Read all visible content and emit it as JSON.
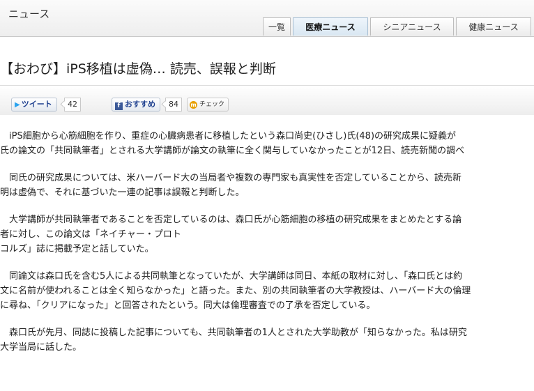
{
  "header": {
    "section_title": "ニュース",
    "tabs": [
      {
        "label": "一覧",
        "active": false
      },
      {
        "label": "医療ニュース",
        "active": true
      },
      {
        "label": "シニアニュース",
        "active": false
      },
      {
        "label": "健康ニュース",
        "active": false
      }
    ]
  },
  "article": {
    "headline": "【おわび】iPS移植は虚偽… 読売、誤報と判断",
    "paragraphs": [
      [
        "　iPS細胞から心筋細胞を作り、重症の心臓病患者に移植したという森口尚史(ひさし)氏(48)の研究成果に疑義が",
        "氏の論文の「共同執筆者」とされる大学講師が論文の執筆に全く関与していなかったことが12日、読売新聞の調べ"
      ],
      [
        "　同氏の研究成果については、米ハーバード大の当局者や複数の専門家も真実性を否定していることから、読売新",
        "明は虚偽で、それに基づいた一連の記事は誤報と判断した。"
      ],
      [
        "　大学講師が共同執筆者であることを否定しているのは、森口氏が心筋細胞の移植の研究成果をまとめたとする論",
        "者に対し、この論文は「ネイチャー・プロト",
        "コルズ」誌に掲載予定と話していた。"
      ],
      [
        "　同論文は森口氏を含む5人による共同執筆となっていたが、大学講師は同日、本紙の取材に対し、「森口氏とは約",
        "文に名前が使われることは全く知らなかった」と語った。また、別の共同執筆者の大学教授は、ハーバード大の倫理",
        "に尋ね、「クリアになった」と回答されたという。同大は倫理審査での了承を否定している。"
      ],
      [
        "　森口氏が先月、同誌に投稿した記事についても、共同執筆者の1人とされた大学助教が「知らなかった。私は研究",
        "大学当局に話した。"
      ]
    ]
  },
  "social": {
    "tweet_label": "ツイート",
    "tweet_count": "42",
    "fb_label": "おすすめ",
    "fb_count": "84",
    "mixi_label": "チェック",
    "mixi_icon_letter": "m",
    "fb_icon_letter": "f",
    "twitter_icon": "twitter-bird-icon"
  },
  "colors": {
    "link": "#1d3f8f",
    "fb": "#3b5998",
    "twitter": "#2aa3ef",
    "mixi": "#e8a000"
  }
}
